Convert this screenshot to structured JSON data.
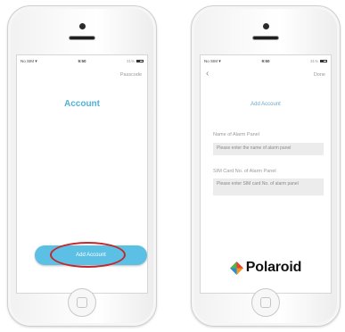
{
  "left_screen": {
    "status": {
      "carrier": "No SIM",
      "time": "9:50",
      "battery": "31%"
    },
    "nav_right": "Passcode",
    "title": "Account",
    "add_button": "Add Account"
  },
  "right_screen": {
    "status": {
      "carrier": "No SIM",
      "time": "9:50",
      "battery": "31%"
    },
    "nav_right": "Done",
    "title": "Add Account",
    "fields": [
      {
        "label": "Name of Alarm Panel",
        "placeholder": "Please enter the name of alarm panel"
      },
      {
        "label": "SIM Card No. of Alarm Panel",
        "placeholder": "Please enter SIM card No. of alarm panel"
      }
    ],
    "logo_text": "Polaroid"
  },
  "colors": {
    "accent": "#5cbfe4",
    "title": "#4fb3d6",
    "highlight_ring": "#c3282e"
  },
  "icons": [
    "back-chevron-icon",
    "wifi-icon",
    "battery-icon",
    "polaroid-logo-icon"
  ]
}
